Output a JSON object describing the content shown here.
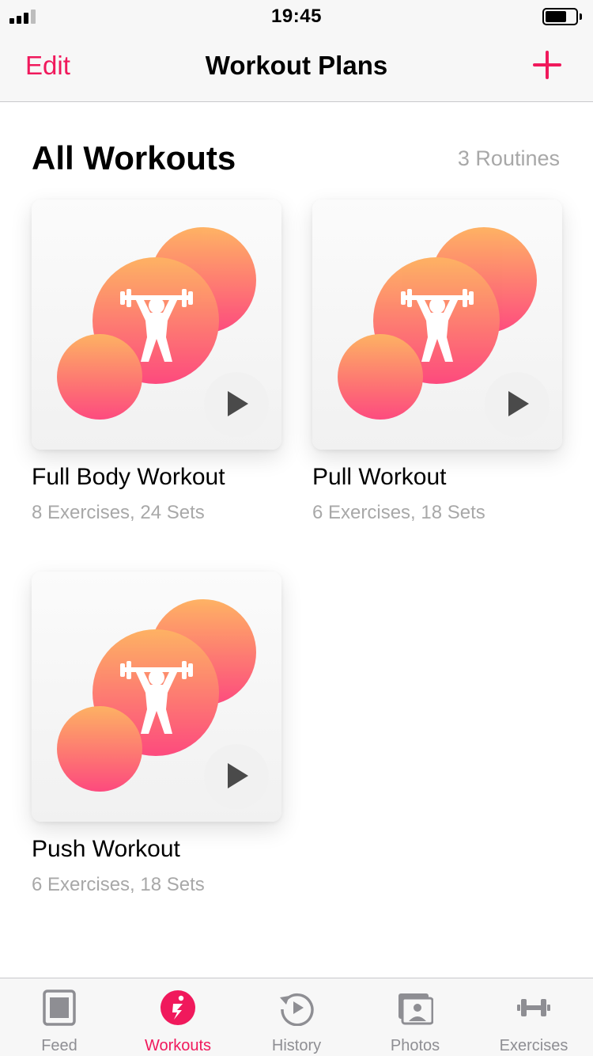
{
  "status_bar": {
    "time": "19:45"
  },
  "nav": {
    "edit_label": "Edit",
    "title": "Workout Plans",
    "add_icon": "plus-icon"
  },
  "section": {
    "title": "All Workouts",
    "count": "3 Routines"
  },
  "workouts": [
    {
      "title": "Full Body Workout",
      "subtitle": "8 Exercises, 24 Sets"
    },
    {
      "title": "Pull Workout",
      "subtitle": "6 Exercises, 18 Sets"
    },
    {
      "title": "Push Workout",
      "subtitle": "6 Exercises, 18 Sets"
    }
  ],
  "tabs": [
    {
      "label": "Feed",
      "icon": "feed-icon",
      "active": false
    },
    {
      "label": "Workouts",
      "icon": "workouts-icon",
      "active": true
    },
    {
      "label": "History",
      "icon": "history-icon",
      "active": false
    },
    {
      "label": "Photos",
      "icon": "photos-icon",
      "active": false
    },
    {
      "label": "Exercises",
      "icon": "dumbbell-icon",
      "active": false
    }
  ],
  "colors": {
    "accent": "#f0195c",
    "secondary_text": "#a8a8a8",
    "tab_inactive": "#8e8e93"
  }
}
